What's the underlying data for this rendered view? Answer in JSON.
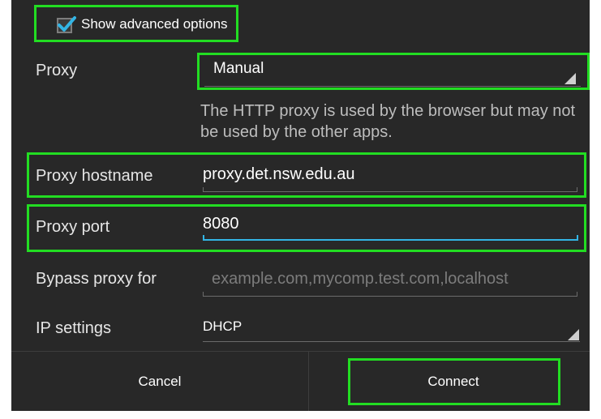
{
  "advanced": {
    "show_advanced_label": "Show advanced options",
    "checked": true
  },
  "proxy": {
    "label": "Proxy",
    "selected": "Manual",
    "note": "The HTTP proxy is used by the browser but may not be used by the other apps."
  },
  "hostname": {
    "label": "Proxy hostname",
    "value": "proxy.det.nsw.edu.au"
  },
  "port": {
    "label": "Proxy port",
    "value": "8080"
  },
  "bypass": {
    "label": "Bypass proxy for",
    "placeholder": "example.com,mycomp.test.com,localhost"
  },
  "ip": {
    "label": "IP settings",
    "selected": "DHCP"
  },
  "buttons": {
    "cancel": "Cancel",
    "connect": "Connect"
  },
  "colors": {
    "highlight": "#22dd22",
    "accent": "#33b5e5",
    "background": "#282828"
  }
}
